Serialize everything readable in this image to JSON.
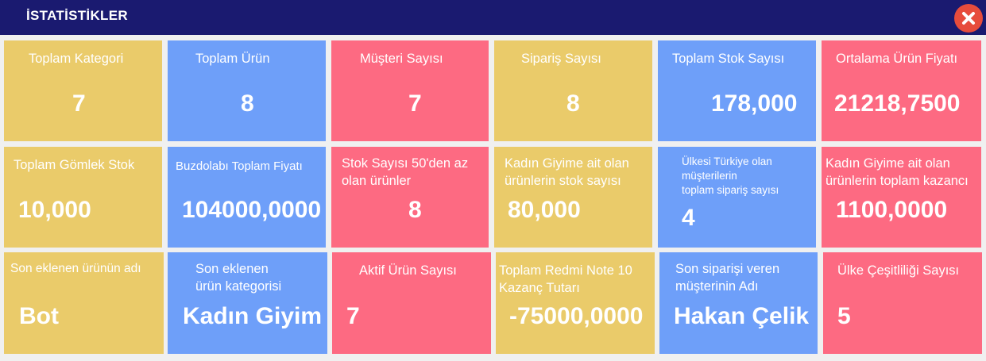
{
  "window": {
    "title": "İSTATİSTİKLER",
    "close_icon": "close-icon"
  },
  "colors": {
    "titlebar": "#1a1a70",
    "yellow": "#eacb6a",
    "blue": "#6e9ff9",
    "red": "#fd6a82",
    "close": "#e74c3c"
  },
  "tiles": [
    {
      "label": "Toplam Kategori",
      "value": "7"
    },
    {
      "label": "Toplam Ürün",
      "value": "8"
    },
    {
      "label": "Müşteri Sayısı",
      "value": "7"
    },
    {
      "label": "Sipariş Sayısı",
      "value": "8"
    },
    {
      "label": "Toplam Stok Sayısı",
      "value": "178,000"
    },
    {
      "label": "Ortalama Ürün Fiyatı",
      "value": "21218,7500"
    },
    {
      "label": "Toplam Gömlek Stok",
      "value": "10,000"
    },
    {
      "label": "Buzdolabı Toplam Fiyatı",
      "value": "104000,0000"
    },
    {
      "label": "Stok Sayısı 50'den az\nolan ürünler",
      "value": "8"
    },
    {
      "label": "Kadın Giyime ait olan\nürünlerin stok sayısı",
      "value": "80,000"
    },
    {
      "label": "Ülkesi Türkiye olan\nmüşterilerin\ntoplam sipariş sayısı",
      "value": "4"
    },
    {
      "label": "Kadın Giyime ait olan\nürünlerin toplam kazancı",
      "value": "1100,0000"
    },
    {
      "label": "Son eklenen ürünün adı",
      "value": "Bot"
    },
    {
      "label": "Son eklenen\nürün kategorisi",
      "value": "Kadın Giyim"
    },
    {
      "label": "Aktif Ürün Sayısı",
      "value": "7"
    },
    {
      "label": "Toplam Redmi Note 10\nKazanç Tutarı",
      "value": "-75000,0000"
    },
    {
      "label": "Son siparişi veren\nmüşterinin Adı",
      "value": "Hakan Çelik"
    },
    {
      "label": "Ülke Çeşitliliği Sayısı",
      "value": "5"
    }
  ]
}
